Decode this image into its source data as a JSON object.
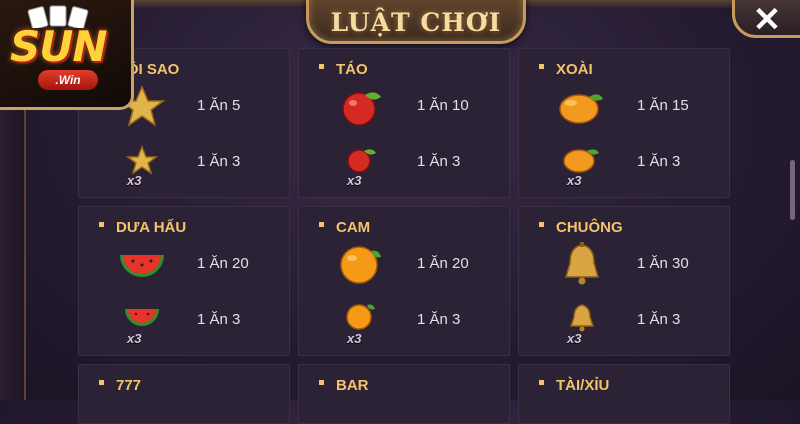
{
  "header": {
    "title": "LUẬT CHƠI",
    "close_label": "✕"
  },
  "logo": {
    "main": "SUN",
    "sub": ".Win"
  },
  "colors": {
    "accent": "#f3c36b",
    "panel": "#2c2235",
    "frame": "#c99a5b"
  },
  "cards": [
    {
      "title": "ĐÔI SAO",
      "rows": [
        {
          "icon": "star-icon",
          "payout": "1 Ăn 5"
        },
        {
          "icon": "star-icon",
          "payout": "1 Ăn 3",
          "mult": "x3"
        }
      ]
    },
    {
      "title": "TÁO",
      "rows": [
        {
          "icon": "apple-icon",
          "payout": "1 Ăn 10"
        },
        {
          "icon": "apple-icon",
          "payout": "1 Ăn 3",
          "mult": "x3"
        }
      ]
    },
    {
      "title": "XOÀI",
      "rows": [
        {
          "icon": "mango-icon",
          "payout": "1 Ăn 15"
        },
        {
          "icon": "mango-icon",
          "payout": "1 Ăn 3",
          "mult": "x3"
        }
      ]
    },
    {
      "title": "DƯA HẤU",
      "rows": [
        {
          "icon": "watermelon-icon",
          "payout": "1 Ăn 20"
        },
        {
          "icon": "watermelon-icon",
          "payout": "1 Ăn 3",
          "mult": "x3"
        }
      ]
    },
    {
      "title": "CAM",
      "rows": [
        {
          "icon": "orange-icon",
          "payout": "1 Ăn 20"
        },
        {
          "icon": "orange-icon",
          "payout": "1 Ăn 3",
          "mult": "x3"
        }
      ]
    },
    {
      "title": "CHUÔNG",
      "rows": [
        {
          "icon": "bell-icon",
          "payout": "1 Ăn 30"
        },
        {
          "icon": "bell-icon",
          "payout": "1 Ăn 3",
          "mult": "x3"
        }
      ]
    },
    {
      "title": "777"
    },
    {
      "title": "BAR"
    },
    {
      "title": "TÀI/XỈU"
    }
  ]
}
